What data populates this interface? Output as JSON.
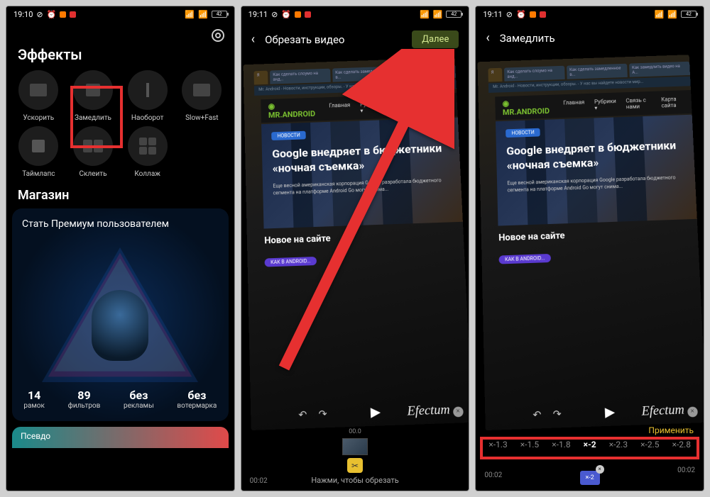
{
  "status": {
    "time1": "19:10",
    "time2": "19:11",
    "time3": "19:11",
    "battery": "42"
  },
  "s1": {
    "title": "Эффекты",
    "effects": [
      "Ускорить",
      "Замедлить",
      "Наоборот",
      "Slow+Fast",
      "Таймлапс",
      "Склеить",
      "Коллаж"
    ],
    "shop_title": "Магазин",
    "premium_title": "Стать Премиум пользователем",
    "stats": [
      {
        "n": "14",
        "t": "рамок"
      },
      {
        "n": "89",
        "t": "фильтров"
      },
      {
        "n": "без",
        "t": "рекламы"
      },
      {
        "n": "без",
        "t": "вотермарка"
      }
    ],
    "pseudo": "Псевдо"
  },
  "s2": {
    "title": "Обрезать видео",
    "next": "Далее",
    "tc_top": "00.0",
    "tc_left": "00:02",
    "hint": "Нажми, чтобы обрезать"
  },
  "s3": {
    "title": "Замедлить",
    "apply": "Применить",
    "speeds": [
      "×-1.3",
      "×-1.5",
      "×-1.8",
      "×-2",
      "×-2.3",
      "×-2.5",
      "×-2.8"
    ],
    "selected_speed": "×-2",
    "tc_left": "00:02",
    "tc_right": "00:02",
    "marker": "×-2"
  },
  "preview": {
    "tab1": "Как сделать слоумо на анд...",
    "tab2": "Как сделать замедленное в...",
    "tab3": "Как замедлить видео на А...",
    "url": "Mr. Android - Новости, инструкции, обзоры. - У нас вы найдете новости мир...",
    "logo": "MR.ANDROID",
    "nav": [
      "Главная",
      "Рубрики ▾",
      "Связь с нами",
      "Карта сайта"
    ],
    "badge": "НОВОСТИ",
    "hero_title_s2": "Google внедряет в бюджетники «ночная съемка»",
    "hero_title_s3": "Google внедряет в бюджетники «ночная съемка»",
    "hero_sub": "Еще весной американская корпорация Google разработала бюджетного сегмента на платформе Android Go могут снима...",
    "section": "Новое на сайте",
    "pill": "КАК В ANDROID...",
    "watermark": "Efectum"
  }
}
